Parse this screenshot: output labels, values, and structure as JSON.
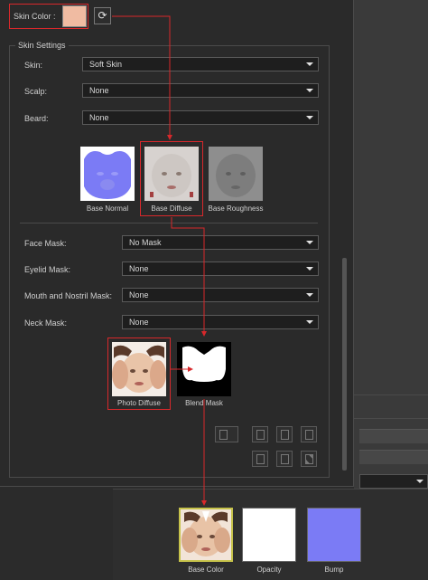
{
  "skin_color": {
    "label": "Skin Color :",
    "swatch": "#f0bba2",
    "reset_icon": "refresh-icon"
  },
  "group": {
    "title": "Skin Settings"
  },
  "skin_rows": [
    {
      "label": "Skin:",
      "value": "Soft Skin"
    },
    {
      "label": "Scalp:",
      "value": "None"
    },
    {
      "label": "Beard:",
      "value": "None"
    }
  ],
  "textures": {
    "base_normal": "Base Normal",
    "base_diffuse": "Base Diffuse",
    "base_roughness": "Base Roughness"
  },
  "mask_rows": [
    {
      "label": "Face Mask:",
      "value": "No Mask"
    },
    {
      "label": "Eyelid Mask:",
      "value": "None"
    },
    {
      "label": "Mouth and Nostril Mask:",
      "value": "None"
    },
    {
      "label": "Neck Mask:",
      "value": "None"
    }
  ],
  "mask_textures": {
    "photo_diffuse": "Photo Diffuse",
    "blend_mask": "Blend Mask"
  },
  "material": {
    "base_color": "Base Color",
    "opacity": "Opacity",
    "bump": "Bump"
  },
  "colors": {
    "highlight": "#d8282b",
    "normal_map": "#7b7bf5",
    "background": "#2a2a2a"
  }
}
